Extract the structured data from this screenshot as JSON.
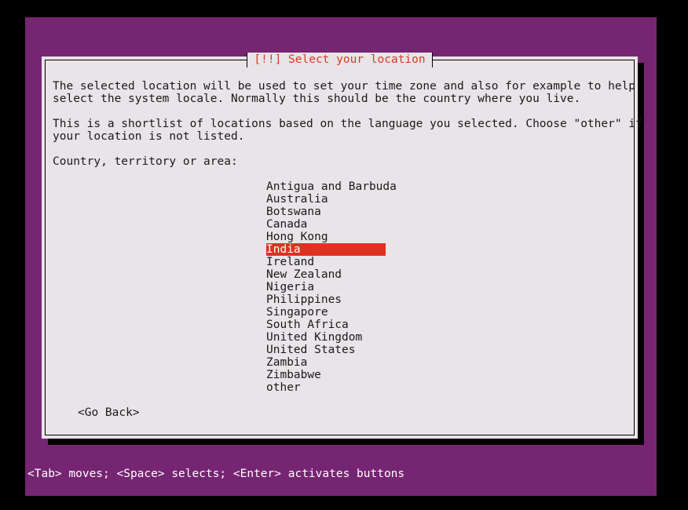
{
  "colors": {
    "screen_bg": "#000000",
    "desktop_purple": "#762572",
    "dialog_bg": "#e8e4e8",
    "title_red": "#d93b26",
    "highlight_red": "#de3222",
    "text_black": "#1a1a1a",
    "footer_text": "#ffffff"
  },
  "dialog": {
    "title": "[!!] Select your location",
    "paragraphs": [
      "The selected location will be used to set your time zone and also for example to help",
      "select the system locale. Normally this should be the country where you live.",
      "",
      "This is a shortlist of locations based on the language you selected. Choose \"other\" if",
      "your location is not listed."
    ],
    "prompt_label": "Country, territory or area:",
    "countries": [
      "Antigua and Barbuda",
      "Australia",
      "Botswana",
      "Canada",
      "Hong Kong",
      "India",
      "Ireland",
      "New Zealand",
      "Nigeria",
      "Philippines",
      "Singapore",
      "South Africa",
      "United Kingdom",
      "United States",
      "Zambia",
      "Zimbabwe",
      "other"
    ],
    "selected_country": "India",
    "selected_index": 5,
    "go_back_label": "<Go Back>"
  },
  "footer": {
    "hint": "<Tab> moves; <Space> selects; <Enter> activates buttons"
  }
}
